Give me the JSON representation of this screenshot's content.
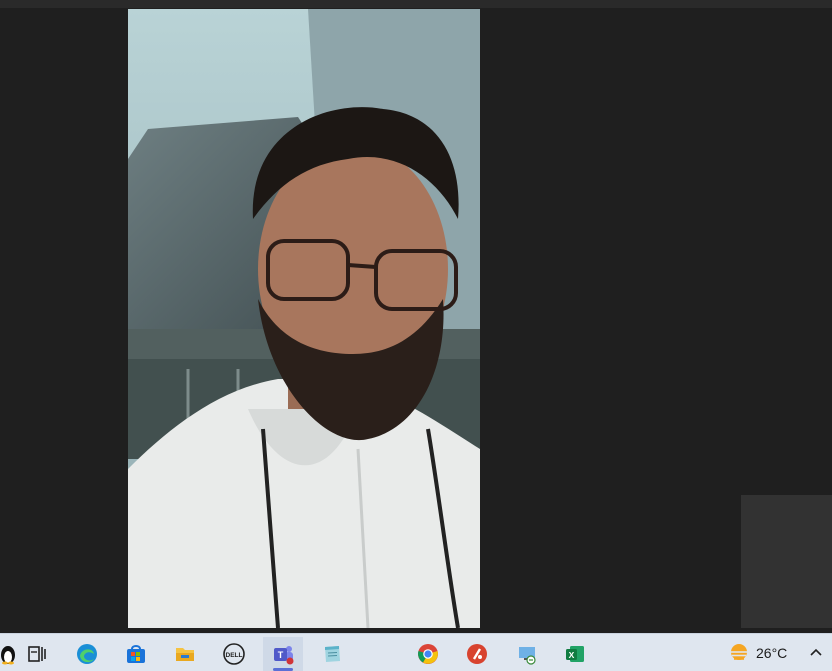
{
  "taskbar": {
    "weather": {
      "temperature": "26°C",
      "icon": "sun-haze-icon"
    },
    "apps": [
      {
        "name": "linux-penguin-icon"
      },
      {
        "name": "task-view-icon"
      },
      {
        "name": "edge-icon"
      },
      {
        "name": "microsoft-store-icon"
      },
      {
        "name": "file-explorer-icon"
      },
      {
        "name": "dell-icon",
        "label": "DELL"
      },
      {
        "name": "teams-icon",
        "label": "T"
      },
      {
        "name": "notepad-icon"
      },
      {
        "name": "chrome-icon"
      },
      {
        "name": "app-red-icon"
      },
      {
        "name": "remote-desktop-icon"
      },
      {
        "name": "excel-icon",
        "label": "X"
      }
    ]
  },
  "colors": {
    "stage_bg": "#1f1f1f",
    "taskbar_bg": "#dfe6ef",
    "accent": "#5b6fd6"
  }
}
